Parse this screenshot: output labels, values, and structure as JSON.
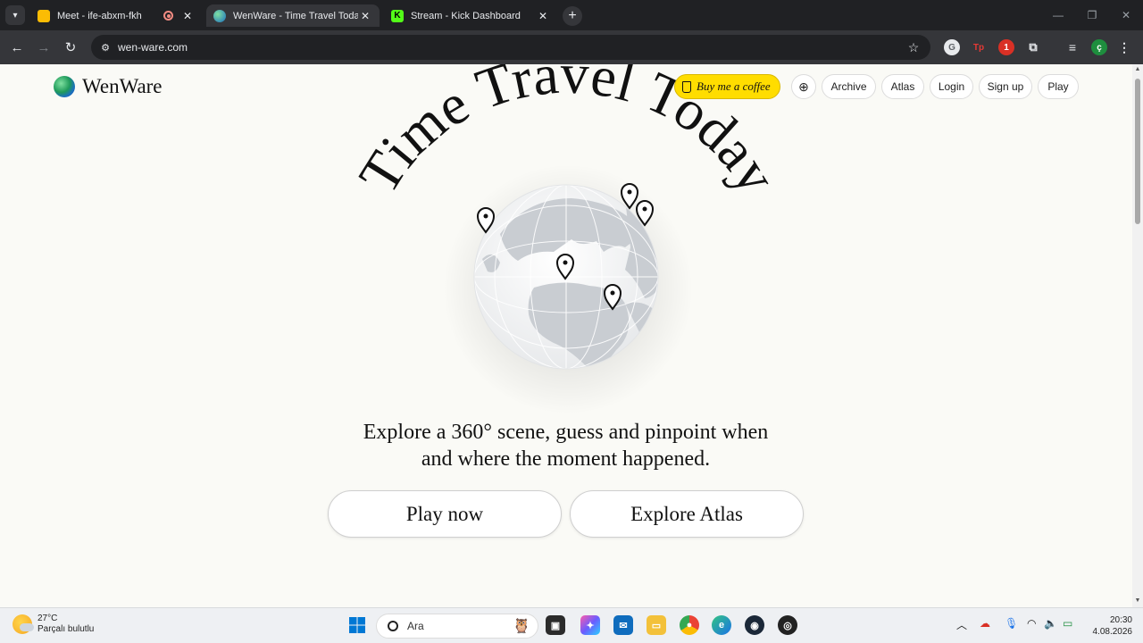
{
  "browser": {
    "tabs": [
      {
        "title": "Meet - ife-abxm-fkh",
        "active": false,
        "icon": "google-meet-icon",
        "recording": true
      },
      {
        "title": "WenWare - Time Travel Today",
        "active": true,
        "icon": "globe-icon"
      },
      {
        "title": "Stream - Kick Dashboard",
        "active": false,
        "icon": "kick-icon"
      }
    ],
    "url": "wen-ware.com",
    "extensions": [
      {
        "name": "grammarly-icon",
        "label": "G",
        "color": "#5f6368"
      },
      {
        "name": "tp-extension-icon",
        "label": "Tp",
        "color": "#e53935"
      },
      {
        "name": "red-extension-icon",
        "label": "1",
        "color": "#d93025"
      },
      {
        "name": "puzzle-extensions-icon",
        "label": "⧉",
        "color": "#e8eaed"
      },
      {
        "name": "media-control-icon",
        "label": "≡",
        "color": "#e8eaed"
      },
      {
        "name": "profile-avatar",
        "label": "ç",
        "color": "#1e8e3e"
      },
      {
        "name": "chrome-menu-icon",
        "label": "⋮",
        "color": "#e8eaed"
      }
    ]
  },
  "site": {
    "logo_text": "WenWare",
    "coffee_label": "Buy me a coffee",
    "nav": [
      "Archive",
      "Atlas",
      "Login",
      "Sign up",
      "Play"
    ],
    "hero_title": "Time Travel Today",
    "tagline_line1": "Explore a 360° scene, guess and pinpoint when",
    "tagline_line2": "and where the moment happened.",
    "cta_primary": "Play now",
    "cta_secondary": "Explore Atlas",
    "map_pins": 5,
    "colors": {
      "coffee": "#ffdd00",
      "background": "#fafaf6",
      "globe_land": "#c9cdd2",
      "globe_ocean": "#f2f3f4"
    }
  },
  "taskbar": {
    "weather_temp": "27°C",
    "weather_desc": "Parçalı bulutlu",
    "search_placeholder": "Ara",
    "time": "20:30",
    "date": "4.08.2026"
  }
}
